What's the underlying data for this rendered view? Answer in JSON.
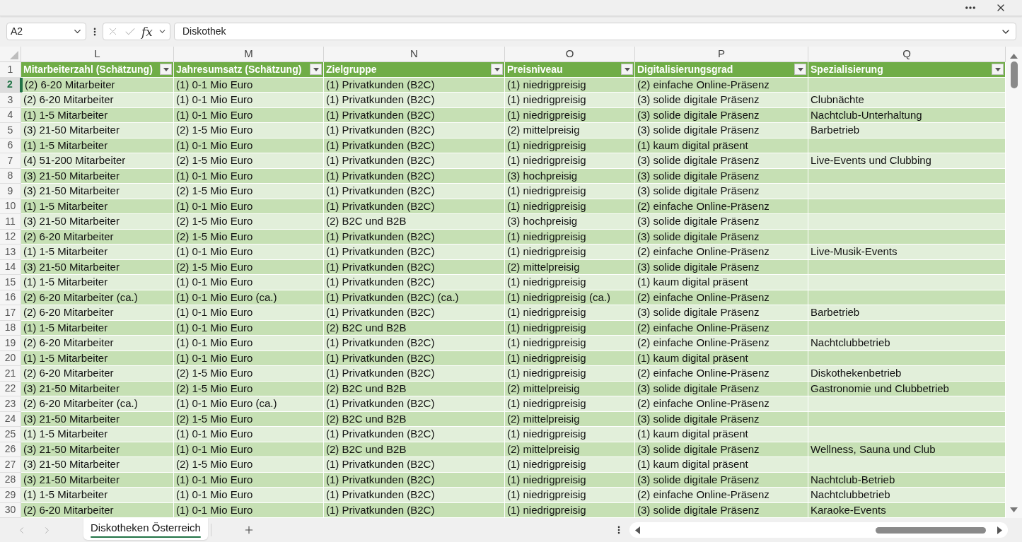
{
  "formula_bar": {
    "name_box": "A2",
    "function_label": "fx",
    "formula": "Diskothek"
  },
  "sheet": {
    "columns": [
      {
        "letter": "L",
        "header": "Mitarbeiterzahl (Schätzung)"
      },
      {
        "letter": "M",
        "header": "Jahresumsatz (Schätzung)"
      },
      {
        "letter": "N",
        "header": "Zielgruppe"
      },
      {
        "letter": "O",
        "header": "Preisniveau"
      },
      {
        "letter": "P",
        "header": "Digitalisierungsgrad"
      },
      {
        "letter": "Q",
        "header": "Spezialisierung"
      }
    ],
    "header_row_number": "1",
    "rows": [
      {
        "number": "2",
        "selected": true,
        "employees": "(2) 6-20 Mitarbeiter",
        "revenue": "(1) 0-1 Mio Euro",
        "target_group": "(1) Privatkunden (B2C)",
        "price_level": "(1) niedrigpreisig",
        "digitalization": "(2) einfache Online-Präsenz"
      },
      {
        "number": "3",
        "selected": false,
        "employees": "(2) 6-20 Mitarbeiter",
        "revenue": "(1) 0-1 Mio Euro",
        "target_group": "(1) Privatkunden (B2C)",
        "price_level": "(1) niedrigpreisig",
        "digitalization": "(3) solide digitale Präsenz",
        "specialization": "Clubnächte"
      },
      {
        "number": "4",
        "selected": false,
        "employees": "(1) 1-5 Mitarbeiter",
        "revenue": "(1) 0-1 Mio Euro",
        "target_group": "(1) Privatkunden (B2C)",
        "price_level": "(1) niedrigpreisig",
        "digitalization": "(3) solide digitale Präsenz",
        "specialization": "Nachtclub-Unterhaltung"
      },
      {
        "number": "5",
        "selected": false,
        "employees": "(3) 21-50 Mitarbeiter",
        "revenue": "(2) 1-5 Mio Euro",
        "target_group": "(1) Privatkunden (B2C)",
        "price_level": "(2) mittelpreisig",
        "digitalization": "(3) solide digitale Präsenz",
        "specialization": "Barbetrieb"
      },
      {
        "number": "6",
        "selected": false,
        "employees": "(1) 1-5 Mitarbeiter",
        "revenue": "(1) 0-1 Mio Euro",
        "target_group": "(1) Privatkunden (B2C)",
        "price_level": "(1) niedrigpreisig",
        "digitalization": "(1) kaum digital präsent"
      },
      {
        "number": "7",
        "selected": false,
        "employees": "(4) 51-200 Mitarbeiter",
        "revenue": "(2) 1-5 Mio Euro",
        "target_group": "(1) Privatkunden (B2C)",
        "price_level": "(1) niedrigpreisig",
        "digitalization": "(3) solide digitale Präsenz",
        "specialization": "Live-Events und Clubbing"
      },
      {
        "number": "8",
        "selected": false,
        "employees": "(3) 21-50 Mitarbeiter",
        "revenue": "(1) 0-1 Mio Euro",
        "target_group": "(1) Privatkunden (B2C)",
        "price_level": "(3) hochpreisig",
        "digitalization": "(3) solide digitale Präsenz"
      },
      {
        "number": "9",
        "selected": false,
        "employees": "(3) 21-50 Mitarbeiter",
        "revenue": "(2) 1-5 Mio Euro",
        "target_group": "(1) Privatkunden (B2C)",
        "price_level": "(1) niedrigpreisig",
        "digitalization": "(3) solide digitale Präsenz"
      },
      {
        "number": "10",
        "selected": false,
        "employees": "(1) 1-5 Mitarbeiter",
        "revenue": "(1) 0-1 Mio Euro",
        "target_group": "(1) Privatkunden (B2C)",
        "price_level": "(1) niedrigpreisig",
        "digitalization": "(2) einfache Online-Präsenz"
      },
      {
        "number": "11",
        "selected": false,
        "employees": "(3) 21-50 Mitarbeiter",
        "revenue": "(2) 1-5 Mio Euro",
        "target_group": "(2) B2C und B2B",
        "price_level": "(3) hochpreisig",
        "digitalization": "(3) solide digitale Präsenz"
      },
      {
        "number": "12",
        "selected": false,
        "employees": "(2) 6-20 Mitarbeiter",
        "revenue": "(2) 1-5 Mio Euro",
        "target_group": "(1) Privatkunden (B2C)",
        "price_level": "(1) niedrigpreisig",
        "digitalization": "(3) solide digitale Präsenz"
      },
      {
        "number": "13",
        "selected": false,
        "employees": "(1) 1-5 Mitarbeiter",
        "revenue": "(1) 0-1 Mio Euro",
        "target_group": "(1) Privatkunden (B2C)",
        "price_level": "(1) niedrigpreisig",
        "digitalization": "(2) einfache Online-Präsenz",
        "specialization": "Live-Musik-Events"
      },
      {
        "number": "14",
        "selected": false,
        "employees": "(3) 21-50 Mitarbeiter",
        "revenue": "(2) 1-5 Mio Euro",
        "target_group": "(1) Privatkunden (B2C)",
        "price_level": "(2) mittelpreisig",
        "digitalization": "(3) solide digitale Präsenz"
      },
      {
        "number": "15",
        "selected": false,
        "employees": "(1) 1-5 Mitarbeiter",
        "revenue": "(1) 0-1 Mio Euro",
        "target_group": "(1) Privatkunden (B2C)",
        "price_level": "(1) niedrigpreisig",
        "digitalization": "(1) kaum digital präsent"
      },
      {
        "number": "16",
        "selected": false,
        "employees": "(2) 6-20 Mitarbeiter (ca.)",
        "revenue": "(1) 0-1 Mio Euro (ca.)",
        "target_group": "(1) Privatkunden (B2C) (ca.)",
        "price_level": "(1) niedrigpreisig (ca.)",
        "digitalization": "(2) einfache Online-Präsenz"
      },
      {
        "number": "17",
        "selected": false,
        "employees": "(2) 6-20 Mitarbeiter",
        "revenue": "(1) 0-1 Mio Euro",
        "target_group": "(1) Privatkunden (B2C)",
        "price_level": "(1) niedrigpreisig",
        "digitalization": "(3) solide digitale Präsenz",
        "specialization": "Barbetrieb"
      },
      {
        "number": "18",
        "selected": false,
        "employees": "(1) 1-5 Mitarbeiter",
        "revenue": "(1) 0-1 Mio Euro",
        "target_group": "(2) B2C und B2B",
        "price_level": "(1) niedrigpreisig",
        "digitalization": "(2) einfache Online-Präsenz"
      },
      {
        "number": "19",
        "selected": false,
        "employees": "(2) 6-20 Mitarbeiter",
        "revenue": "(1) 0-1 Mio Euro",
        "target_group": "(1) Privatkunden (B2C)",
        "price_level": "(1) niedrigpreisig",
        "digitalization": "(2) einfache Online-Präsenz",
        "specialization": "Nachtclubbetrieb"
      },
      {
        "number": "20",
        "selected": false,
        "employees": "(1) 1-5 Mitarbeiter",
        "revenue": "(1) 0-1 Mio Euro",
        "target_group": "(1) Privatkunden (B2C)",
        "price_level": "(1) niedrigpreisig",
        "digitalization": "(1) kaum digital präsent"
      },
      {
        "number": "21",
        "selected": false,
        "employees": "(2) 6-20 Mitarbeiter",
        "revenue": "(2) 1-5 Mio Euro",
        "target_group": "(1) Privatkunden (B2C)",
        "price_level": "(1) niedrigpreisig",
        "digitalization": "(2) einfache Online-Präsenz",
        "specialization": "Diskothekenbetrieb"
      },
      {
        "number": "22",
        "selected": false,
        "employees": "(3) 21-50 Mitarbeiter",
        "revenue": "(2) 1-5 Mio Euro",
        "target_group": "(2) B2C und B2B",
        "price_level": "(2) mittelpreisig",
        "digitalization": "(3) solide digitale Präsenz",
        "specialization": "Gastronomie und Clubbetrieb"
      },
      {
        "number": "23",
        "selected": false,
        "employees": "(2) 6-20 Mitarbeiter (ca.)",
        "revenue": "(1) 0-1 Mio Euro (ca.)",
        "target_group": "(1) Privatkunden (B2C)",
        "price_level": "(1) niedrigpreisig",
        "digitalization": "(2) einfache Online-Präsenz"
      },
      {
        "number": "24",
        "selected": false,
        "employees": "(3) 21-50 Mitarbeiter",
        "revenue": "(2) 1-5 Mio Euro",
        "target_group": "(2) B2C und B2B",
        "price_level": "(2) mittelpreisig",
        "digitalization": "(3) solide digitale Präsenz"
      },
      {
        "number": "25",
        "selected": false,
        "employees": "(1) 1-5 Mitarbeiter",
        "revenue": "(1) 0-1 Mio Euro",
        "target_group": "(1) Privatkunden (B2C)",
        "price_level": "(1) niedrigpreisig",
        "digitalization": "(1) kaum digital präsent"
      },
      {
        "number": "26",
        "selected": false,
        "employees": "(3) 21-50 Mitarbeiter",
        "revenue": "(1) 0-1 Mio Euro",
        "target_group": "(2) B2C und B2B",
        "price_level": "(2) mittelpreisig",
        "digitalization": "(3) solide digitale Präsenz",
        "specialization": "Wellness, Sauna und Club"
      },
      {
        "number": "27",
        "selected": false,
        "employees": "(3) 21-50 Mitarbeiter",
        "revenue": "(2) 1-5 Mio Euro",
        "target_group": "(1) Privatkunden (B2C)",
        "price_level": "(1) niedrigpreisig",
        "digitalization": "(1) kaum digital präsent"
      },
      {
        "number": "28",
        "selected": false,
        "employees": "(3) 21-50 Mitarbeiter",
        "revenue": "(1) 0-1 Mio Euro",
        "target_group": "(1) Privatkunden (B2C)",
        "price_level": "(1) niedrigpreisig",
        "digitalization": "(3) solide digitale Präsenz",
        "specialization": "Nachtclub-Betrieb"
      },
      {
        "number": "29",
        "selected": false,
        "employees": "(1) 1-5 Mitarbeiter",
        "revenue": "(1) 0-1 Mio Euro",
        "target_group": "(1) Privatkunden (B2C)",
        "price_level": "(1) niedrigpreisig",
        "digitalization": "(2) einfache Online-Präsenz",
        "specialization": "Nachtclubbetrieb"
      },
      {
        "number": "30",
        "selected": false,
        "employees": "(2) 6-20 Mitarbeiter",
        "revenue": "(1) 0-1 Mio Euro",
        "target_group": "(1) Privatkunden (B2C)",
        "price_level": "(1) niedrigpreisig",
        "digitalization": "(3) solide digitale Präsenz",
        "specialization": "Karaoke-Events"
      }
    ]
  },
  "sheet_tabs": [
    {
      "label": "Diskotheken Österreich",
      "selected": true
    }
  ]
}
